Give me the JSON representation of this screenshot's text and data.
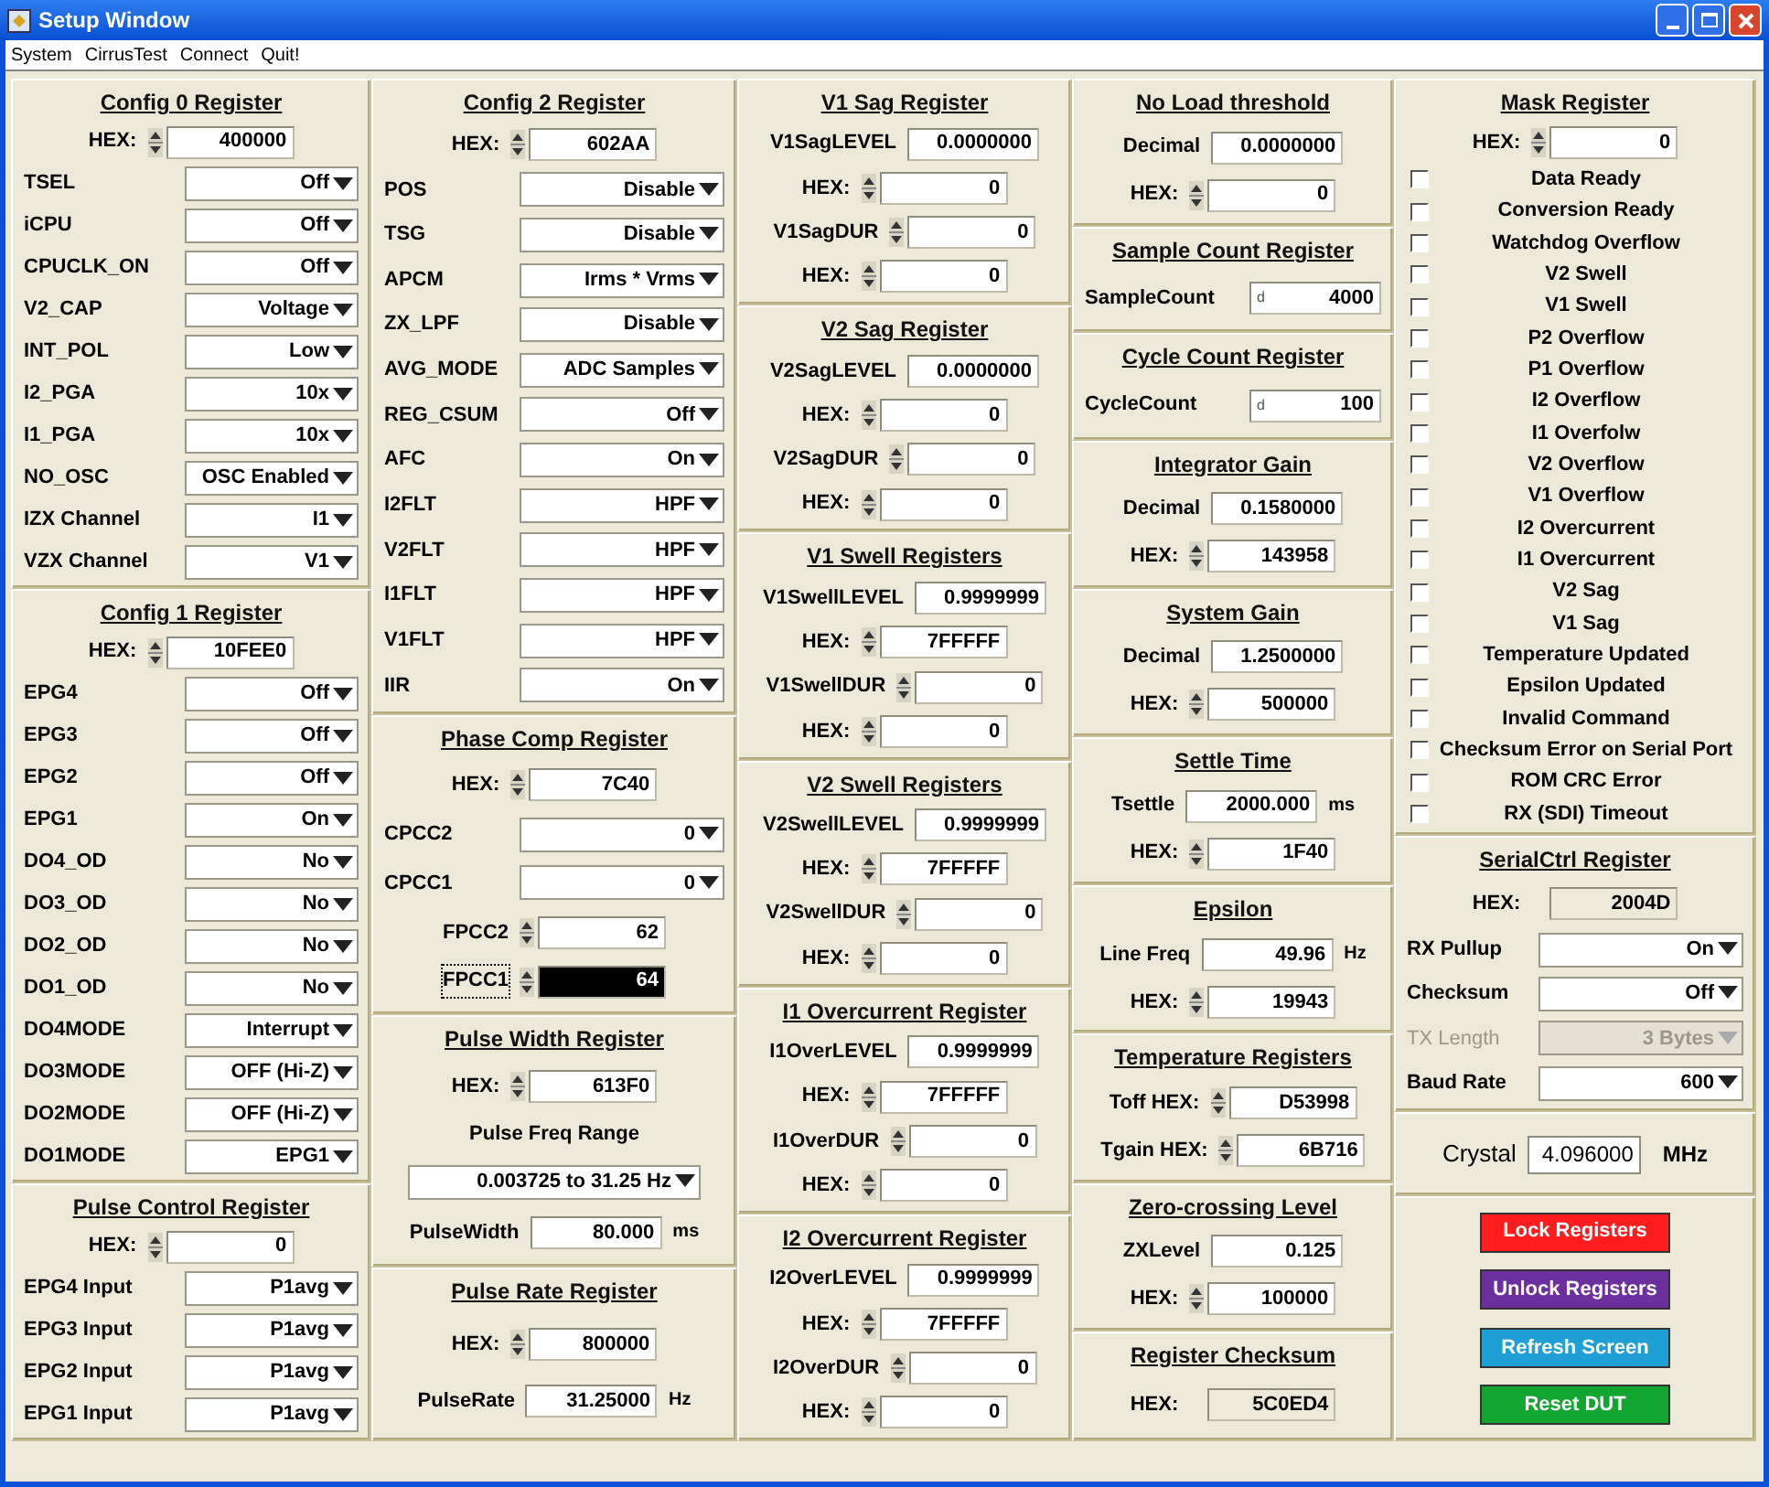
{
  "window": {
    "title": "Setup Window"
  },
  "menu": [
    "System",
    "CirrusTest",
    "Connect",
    "Quit!"
  ],
  "columns": [
    [
      {
        "title": "Config 0 Register",
        "rows": [
          {
            "kind": "spin",
            "label": "HEX:",
            "value": "400000"
          },
          {
            "kind": "select",
            "label": "TSEL",
            "value": "Off"
          },
          {
            "kind": "select",
            "label": "iCPU",
            "value": "Off"
          },
          {
            "kind": "select",
            "label": "CPUCLK_ON",
            "value": "Off"
          },
          {
            "kind": "select",
            "label": "V2_CAP",
            "value": "Voltage"
          },
          {
            "kind": "select",
            "label": "INT_POL",
            "value": "Low"
          },
          {
            "kind": "select",
            "label": "I2_PGA",
            "value": "10x"
          },
          {
            "kind": "select",
            "label": "I1_PGA",
            "value": "10x"
          },
          {
            "kind": "select",
            "label": "NO_OSC",
            "value": "OSC Enabled"
          },
          {
            "kind": "select",
            "label": "IZX Channel",
            "value": "I1"
          },
          {
            "kind": "select",
            "label": "VZX Channel",
            "value": "V1"
          }
        ]
      },
      {
        "title": "Config 1 Register",
        "rows": [
          {
            "kind": "spin",
            "label": "HEX:",
            "value": "10FEE0"
          },
          {
            "kind": "select",
            "label": "EPG4",
            "value": "Off"
          },
          {
            "kind": "select",
            "label": "EPG3",
            "value": "Off"
          },
          {
            "kind": "select",
            "label": "EPG2",
            "value": "Off"
          },
          {
            "kind": "select",
            "label": "EPG1",
            "value": "On"
          },
          {
            "kind": "select",
            "label": "DO4_OD",
            "value": "No"
          },
          {
            "kind": "select",
            "label": "DO3_OD",
            "value": "No"
          },
          {
            "kind": "select",
            "label": "DO2_OD",
            "value": "No"
          },
          {
            "kind": "select",
            "label": "DO1_OD",
            "value": "No"
          },
          {
            "kind": "select",
            "label": "DO4MODE",
            "value": "Interrupt"
          },
          {
            "kind": "select",
            "label": "DO3MODE",
            "value": "OFF (Hi-Z)"
          },
          {
            "kind": "select",
            "label": "DO2MODE",
            "value": "OFF (Hi-Z)"
          },
          {
            "kind": "select",
            "label": "DO1MODE",
            "value": "EPG1"
          }
        ]
      },
      {
        "title": "Pulse Control Register",
        "rows": [
          {
            "kind": "spin",
            "label": "HEX:",
            "value": "0"
          },
          {
            "kind": "select",
            "label": "EPG4 Input",
            "value": "P1avg"
          },
          {
            "kind": "select",
            "label": "EPG3 Input",
            "value": "P1avg"
          },
          {
            "kind": "select",
            "label": "EPG2 Input",
            "value": "P1avg"
          },
          {
            "kind": "select",
            "label": "EPG1 Input",
            "value": "P1avg"
          }
        ]
      }
    ],
    [
      {
        "title": "Config 2 Register",
        "rows": [
          {
            "kind": "spin",
            "label": "HEX:",
            "value": "602AA"
          },
          {
            "kind": "select",
            "label": "POS",
            "value": "Disable"
          },
          {
            "kind": "select",
            "label": "TSG",
            "value": "Disable"
          },
          {
            "kind": "select",
            "label": "APCM",
            "value": "Irms * Vrms"
          },
          {
            "kind": "select",
            "label": "ZX_LPF",
            "value": "Disable"
          },
          {
            "kind": "select",
            "label": "AVG_MODE",
            "value": "ADC Samples"
          },
          {
            "kind": "select",
            "label": "REG_CSUM",
            "value": "Off"
          },
          {
            "kind": "select",
            "label": "AFC",
            "value": "On"
          },
          {
            "kind": "select",
            "label": "I2FLT",
            "value": "HPF"
          },
          {
            "kind": "select",
            "label": "V2FLT",
            "value": "HPF"
          },
          {
            "kind": "select",
            "label": "I1FLT",
            "value": "HPF"
          },
          {
            "kind": "select",
            "label": "V1FLT",
            "value": "HPF"
          },
          {
            "kind": "select",
            "label": "IIR",
            "value": "On"
          }
        ]
      },
      {
        "title": "Phase Comp Register",
        "rows": [
          {
            "kind": "spin",
            "label": "HEX:",
            "value": "7C40",
            "focused": false
          },
          {
            "kind": "select",
            "label": "CPCC2",
            "value": "0",
            "focused": false
          },
          {
            "kind": "select",
            "label": "CPCC1",
            "value": "0",
            "focused": false
          },
          {
            "kind": "spin",
            "label": "FPCC2",
            "value": "62",
            "focused": false
          },
          {
            "kind": "spin",
            "label": "FPCC1",
            "value": "64",
            "focused": true
          }
        ]
      },
      {
        "title": "Pulse Width Register",
        "rows": [
          {
            "kind": "spin",
            "label": "HEX:",
            "value": "613F0"
          },
          {
            "kind": "caption",
            "label": "Pulse Freq Range"
          },
          {
            "kind": "select",
            "value": "0.003725 to 31.25 Hz"
          },
          {
            "kind": "field",
            "label": "PulseWidth",
            "value": "80.000",
            "unit": "ms"
          }
        ]
      },
      {
        "title": "Pulse Rate Register",
        "rows": [
          {
            "kind": "spin",
            "label": "HEX:",
            "value": "800000"
          },
          {
            "kind": "field",
            "label": "PulseRate",
            "value": "31.25000",
            "unit": "Hz"
          }
        ]
      }
    ],
    [
      {
        "title": "V1 Sag Register",
        "rows": [
          {
            "kind": "field",
            "label": "V1SagLEVEL",
            "value": "0.0000000"
          },
          {
            "kind": "spin",
            "label": "HEX:",
            "value": "0"
          },
          {
            "kind": "spin",
            "label": "V1SagDUR",
            "value": "0"
          },
          {
            "kind": "spin",
            "label": "HEX:",
            "value": "0"
          }
        ]
      },
      {
        "title": "V2 Sag Register",
        "rows": [
          {
            "kind": "field",
            "label": "V2SagLEVEL",
            "value": "0.0000000"
          },
          {
            "kind": "spin",
            "label": "HEX:",
            "value": "0"
          },
          {
            "kind": "spin",
            "label": "V2SagDUR",
            "value": "0"
          },
          {
            "kind": "spin",
            "label": "HEX:",
            "value": "0"
          }
        ]
      },
      {
        "title": "V1 Swell Registers",
        "rows": [
          {
            "kind": "field",
            "label": "V1SwellLEVEL",
            "value": "0.9999999"
          },
          {
            "kind": "spin",
            "label": "HEX:",
            "value": "7FFFFF"
          },
          {
            "kind": "spin",
            "label": "V1SwellDUR",
            "value": "0"
          },
          {
            "kind": "spin",
            "label": "HEX:",
            "value": "0"
          }
        ]
      },
      {
        "title": "V2 Swell Registers",
        "rows": [
          {
            "kind": "field",
            "label": "V2SwellLEVEL",
            "value": "0.9999999"
          },
          {
            "kind": "spin",
            "label": "HEX:",
            "value": "7FFFFF"
          },
          {
            "kind": "spin",
            "label": "V2SwellDUR",
            "value": "0"
          },
          {
            "kind": "spin",
            "label": "HEX:",
            "value": "0"
          }
        ]
      },
      {
        "title": "I1 Overcurrent Register",
        "rows": [
          {
            "kind": "field",
            "label": "I1OverLEVEL",
            "value": "0.9999999"
          },
          {
            "kind": "spin",
            "label": "HEX:",
            "value": "7FFFFF"
          },
          {
            "kind": "spin",
            "label": "I1OverDUR",
            "value": "0"
          },
          {
            "kind": "spin",
            "label": "HEX:",
            "value": "0"
          }
        ]
      },
      {
        "title": "I2 Overcurrent Register",
        "rows": [
          {
            "kind": "field",
            "label": "I2OverLEVEL",
            "value": "0.9999999"
          },
          {
            "kind": "spin",
            "label": "HEX:",
            "value": "7FFFFF"
          },
          {
            "kind": "spin",
            "label": "I2OverDUR",
            "value": "0"
          },
          {
            "kind": "spin",
            "label": "HEX:",
            "value": "0"
          }
        ]
      }
    ],
    [
      {
        "title": "No Load threshold",
        "rows": [
          {
            "kind": "field",
            "label": "Decimal",
            "value": "0.0000000"
          },
          {
            "kind": "spin",
            "label": "HEX:",
            "value": "0"
          }
        ]
      },
      {
        "title": "Sample Count Register",
        "rows": [
          {
            "kind": "count",
            "label": "SampleCount",
            "radix": "d",
            "value": "4000"
          }
        ]
      },
      {
        "title": "Cycle Count Register",
        "rows": [
          {
            "kind": "count",
            "label": "CycleCount",
            "radix": "d",
            "value": "100"
          }
        ]
      },
      {
        "title": "Integrator Gain",
        "rows": [
          {
            "kind": "field",
            "label": "Decimal",
            "value": "0.1580000"
          },
          {
            "kind": "spin",
            "label": "HEX:",
            "value": "143958"
          }
        ]
      },
      {
        "title": "System Gain",
        "rows": [
          {
            "kind": "field",
            "label": "Decimal",
            "value": "1.2500000"
          },
          {
            "kind": "spin",
            "label": "HEX:",
            "value": "500000"
          }
        ]
      },
      {
        "title": "Settle Time",
        "rows": [
          {
            "kind": "field",
            "label": "Tsettle",
            "value": "2000.000",
            "unit": "ms"
          },
          {
            "kind": "spin",
            "label": "HEX:",
            "value": "1F40"
          }
        ]
      },
      {
        "title": "Epsilon",
        "rows": [
          {
            "kind": "field",
            "label": "Line Freq",
            "value": "49.96",
            "unit": "Hz"
          },
          {
            "kind": "spin",
            "label": "HEX:",
            "value": "19943"
          }
        ]
      },
      {
        "title": "Temperature Registers",
        "rows": [
          {
            "kind": "spin",
            "label": "Toff HEX:",
            "value": "D53998"
          },
          {
            "kind": "spin",
            "label": "Tgain HEX:",
            "value": "6B716"
          }
        ]
      },
      {
        "title": "Zero-crossing Level",
        "rows": [
          {
            "kind": "field",
            "label": "ZXLevel",
            "value": "0.125"
          },
          {
            "kind": "spin",
            "label": "HEX:",
            "value": "100000"
          }
        ]
      },
      {
        "title": "Register Checksum",
        "rows": [
          {
            "kind": "readout",
            "label": "HEX:",
            "value": "5C0ED4"
          }
        ]
      }
    ],
    [
      {
        "title": "Mask Register",
        "rows": [
          {
            "kind": "spin",
            "label": "HEX:",
            "value": "0"
          },
          {
            "kind": "check",
            "label": "Data Ready",
            "checked": false
          },
          {
            "kind": "check",
            "label": "Conversion Ready",
            "checked": false
          },
          {
            "kind": "check",
            "label": "Watchdog Overflow",
            "checked": false
          },
          {
            "kind": "check",
            "label": "V2 Swell",
            "checked": false
          },
          {
            "kind": "check",
            "label": "V1 Swell",
            "checked": false
          },
          {
            "kind": "check",
            "label": "P2 Overflow",
            "checked": false
          },
          {
            "kind": "check",
            "label": "P1 Overflow",
            "checked": false
          },
          {
            "kind": "check",
            "label": "I2 Overflow",
            "checked": false
          },
          {
            "kind": "check",
            "label": "I1 Overfolw",
            "checked": false
          },
          {
            "kind": "check",
            "label": "V2 Overflow",
            "checked": false
          },
          {
            "kind": "check",
            "label": "V1 Overflow",
            "checked": false
          },
          {
            "kind": "check",
            "label": "I2 Overcurrent",
            "checked": false
          },
          {
            "kind": "check",
            "label": "I1 Overcurrent",
            "checked": false
          },
          {
            "kind": "check",
            "label": "V2 Sag",
            "checked": false
          },
          {
            "kind": "check",
            "label": "V1 Sag",
            "checked": false
          },
          {
            "kind": "check",
            "label": "Temperature Updated",
            "checked": false
          },
          {
            "kind": "check",
            "label": "Epsilon Updated",
            "checked": false
          },
          {
            "kind": "check",
            "label": "Invalid Command",
            "checked": false
          },
          {
            "kind": "check",
            "label": "Checksum Error on Serial Port",
            "checked": false
          },
          {
            "kind": "check",
            "label": "ROM CRC Error",
            "checked": false
          },
          {
            "kind": "check",
            "label": "RX (SDI) Timeout",
            "checked": false
          }
        ]
      },
      {
        "title": "SerialCtrl Register",
        "rows": [
          {
            "kind": "readout",
            "label": "HEX:",
            "value": "2004D"
          },
          {
            "kind": "select",
            "label": "RX Pullup",
            "value": "On",
            "disabled": false
          },
          {
            "kind": "select",
            "label": "Checksum",
            "value": "Off",
            "disabled": false
          },
          {
            "kind": "select",
            "label": "TX Length",
            "value": "3 Bytes",
            "disabled": true
          },
          {
            "kind": "select",
            "label": "Baud Rate",
            "value": "600",
            "disabled": false
          }
        ]
      },
      {
        "rows": [
          {
            "kind": "crystal",
            "label": "Crystal",
            "value": "4.096000",
            "unit": "MHz"
          }
        ]
      },
      {
        "rows": [
          {
            "kind": "button",
            "label": "Lock Registers",
            "color": "#ff1c1c"
          },
          {
            "kind": "button",
            "label": "Unlock Registers",
            "color": "#6b2f9e"
          },
          {
            "kind": "button",
            "label": "Refresh Screen",
            "color": "#1e9fd6"
          },
          {
            "kind": "button",
            "label": "Reset DUT",
            "color": "#12a631"
          }
        ]
      }
    ]
  ]
}
